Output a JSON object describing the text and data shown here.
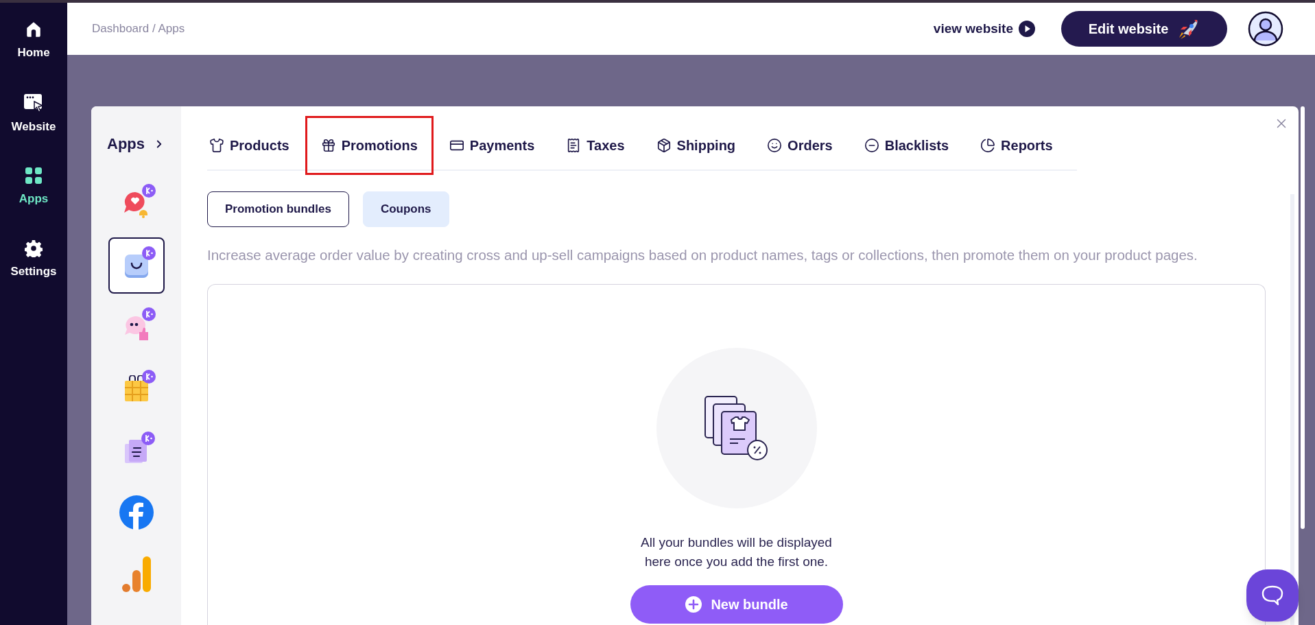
{
  "nav": [
    {
      "label": "Home",
      "selected": false
    },
    {
      "label": "Website",
      "selected": false
    },
    {
      "label": "Apps",
      "selected": true
    },
    {
      "label": "Settings",
      "selected": false
    }
  ],
  "breadcrumb": "Dashboard / Apps",
  "header": {
    "view_link": "view website",
    "edit_button": "Edit website"
  },
  "apps_panel": {
    "title": "Apps",
    "items": [
      {
        "kind": "heart-chat",
        "badge": true,
        "selected": false
      },
      {
        "kind": "bag",
        "badge": true,
        "selected": true
      },
      {
        "kind": "quote-chat",
        "badge": true,
        "selected": false
      },
      {
        "kind": "calendar",
        "badge": true,
        "selected": false
      },
      {
        "kind": "document",
        "badge": true,
        "selected": false
      },
      {
        "kind": "facebook",
        "badge": false,
        "selected": false
      },
      {
        "kind": "analytics",
        "badge": false,
        "selected": false
      }
    ]
  },
  "tabs": [
    {
      "label": "Products",
      "highlighted": false
    },
    {
      "label": "Promotions",
      "highlighted": true
    },
    {
      "label": "Payments",
      "highlighted": false
    },
    {
      "label": "Taxes",
      "highlighted": false
    },
    {
      "label": "Shipping",
      "highlighted": false
    },
    {
      "label": "Orders",
      "highlighted": false
    },
    {
      "label": "Blacklists",
      "highlighted": false
    },
    {
      "label": "Reports",
      "highlighted": false
    }
  ],
  "sub_tabs": [
    {
      "label": "Promotion bundles",
      "selected": true
    },
    {
      "label": "Coupons",
      "selected": false
    }
  ],
  "description": "Increase average order value by creating cross and up-sell campaigns based on product names, tags or collections, then promote them on your product pages.",
  "empty_state": {
    "message": "All your bundles will be displayed here once you add the first one.",
    "button": "New bundle"
  }
}
